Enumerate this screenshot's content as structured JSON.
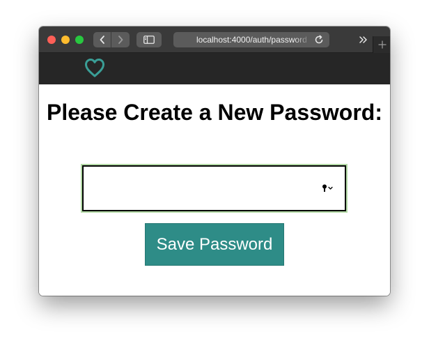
{
  "browser": {
    "address_url": "localhost:4000/auth/password",
    "icons": {
      "back": "chevron-left-icon",
      "forward": "chevron-right-icon",
      "sidebar": "sidebar-icon",
      "reload": "reload-icon",
      "overflow": "double-chevron-right-icon",
      "new_tab": "plus-icon"
    },
    "colors": {
      "titlebar": "#3a3a3a",
      "close": "#fe5f57",
      "minimize": "#febc2e",
      "zoom": "#28c840"
    }
  },
  "app_nav": {
    "logo_icon": "heart-outline-icon",
    "logo_color": "#3a9e96",
    "background": "#262626"
  },
  "form": {
    "heading": "Please Create a New Password:",
    "password_value": "",
    "password_icon": "key-icon",
    "save_label": "Save Password",
    "accent": "#2e8c87",
    "focus_ring": "#b3d9a6"
  }
}
